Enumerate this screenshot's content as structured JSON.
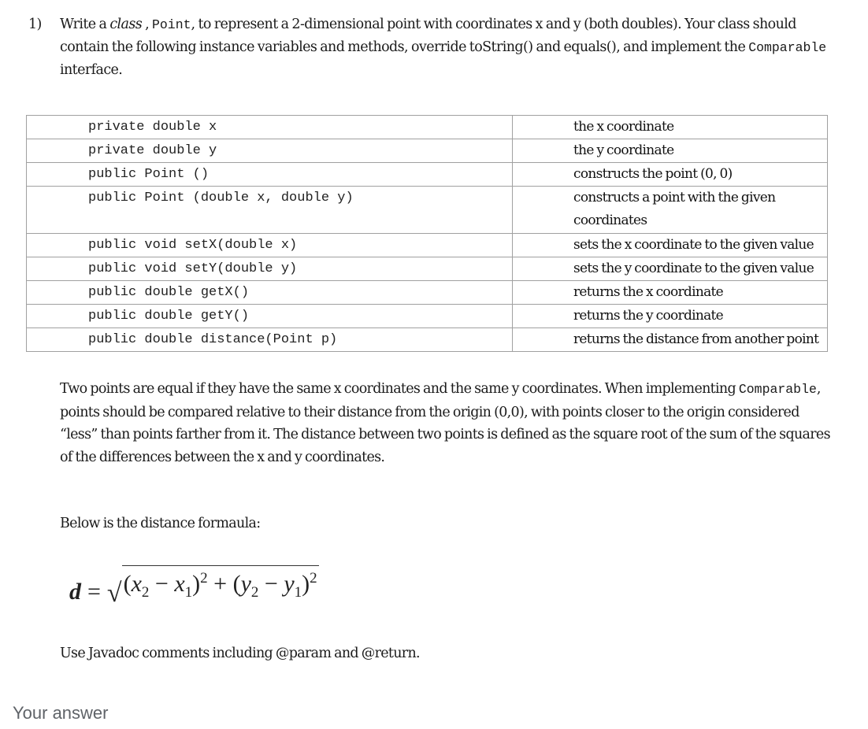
{
  "question": {
    "number": "1)",
    "intro_1": "Write a ",
    "intro_class_word": "class",
    "intro_2": " , ",
    "intro_class_name": "Point",
    "intro_3": ", to represent a 2-dimensional point with  coordinates x and y (both doubles).  Your class should contain the following instance variables and methods, override toString() and equals(), and implement the ",
    "intro_interface": "Comparable",
    "intro_4": " interface."
  },
  "spec_table": {
    "rows": [
      {
        "signature": "private double x",
        "description": "the x coordinate"
      },
      {
        "signature": "private double y",
        "description": "the y coordinate"
      },
      {
        "signature": "public Point ()",
        "description": "constructs the point (0, 0)"
      },
      {
        "signature": "public Point (double x, double y)",
        "description": "constructs a point with the given coordinates"
      },
      {
        "signature": "public void setX(double x)",
        "description": "sets the x coordinate to the given value"
      },
      {
        "signature": "public void setY(double y)",
        "description": "sets the y coordinate to the given value"
      },
      {
        "signature": "public double getX()",
        "description": "returns the x coordinate"
      },
      {
        "signature": "public double getY()",
        "description": "returns the y coordinate"
      },
      {
        "signature": "public double distance(Point p)",
        "description": "returns the distance from another point"
      }
    ]
  },
  "equality_paragraph": {
    "part_1": "Two points are equal if they have the same x coordinates and the same y coordinates.  When implementing ",
    "code": "Comparable",
    "part_2": ", points should be compared relative to their distance from the origin (0,0), with points closer to the origin considered “less” than points farther from it.  The distance between two points is defined as the square root of the sum of the squares of the differences between the x and y coordinates."
  },
  "formula_intro": "Below is the distance formaula:",
  "formula": {
    "lhs": "d",
    "equals": "=",
    "radical": "√",
    "open1": "(",
    "x2": "x",
    "x2_sub": "2",
    "minus1": " − ",
    "x1": "x",
    "x1_sub": "1",
    "close1": ")",
    "sq1": "2",
    "plus": " + ",
    "open2": "(",
    "y2": "y",
    "y2_sub": "2",
    "minus2": " − ",
    "y1": "y",
    "y1_sub": "1",
    "close2": ")",
    "sq2": "2"
  },
  "javadoc_note": "Use Javadoc comments including @param and @return.",
  "answer_label": "Your answer"
}
